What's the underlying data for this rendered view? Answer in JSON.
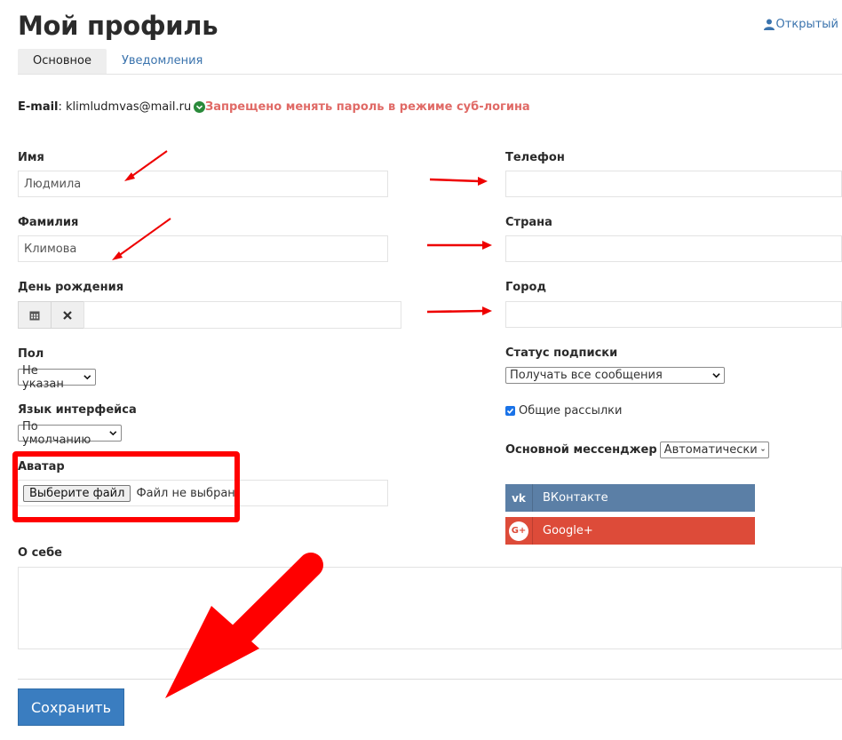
{
  "page": {
    "title": "Мой профиль",
    "visibility": "Открытый",
    "tabs": [
      "Основное",
      "Уведомления"
    ],
    "email_label": "E-mail",
    "email_value": "klimludmvas@mail.ru",
    "warning": "Запрещено менять пароль в режиме суб-логина"
  },
  "form": {
    "first_name": {
      "label": "Имя",
      "value": "Людмила"
    },
    "last_name": {
      "label": "Фамилия",
      "value": "Климова"
    },
    "birthday": {
      "label": "День рождения",
      "value": ""
    },
    "gender": {
      "label": "Пол",
      "value": "Не указан"
    },
    "language": {
      "label": "Язык интерфейса",
      "value": "По умолчанию"
    },
    "avatar": {
      "label": "Аватар",
      "button": "Выберите файл",
      "status": "Файл не выбран"
    },
    "about": {
      "label": "О себе",
      "value": ""
    },
    "phone": {
      "label": "Телефон",
      "value": ""
    },
    "country": {
      "label": "Страна",
      "value": ""
    },
    "city": {
      "label": "Город",
      "value": ""
    },
    "subscription": {
      "label": "Статус подписки",
      "value": "Получать все сообщения"
    },
    "newsletters": {
      "label": "Общие рассылки",
      "checked": true
    },
    "messenger": {
      "label": "Основной мессенджер",
      "value": "Автоматически"
    }
  },
  "social": [
    {
      "name": "ВКонтакте",
      "color": "#5b7fa6",
      "icon": "vk-icon"
    },
    {
      "name": "Google+",
      "color": "#dd4b39",
      "icon": "google-plus-icon"
    }
  ],
  "actions": {
    "save": "Сохранить"
  },
  "colors": {
    "accent": "#3a7dc0",
    "warning": "#e06a66",
    "annotation": "#ff0000"
  }
}
